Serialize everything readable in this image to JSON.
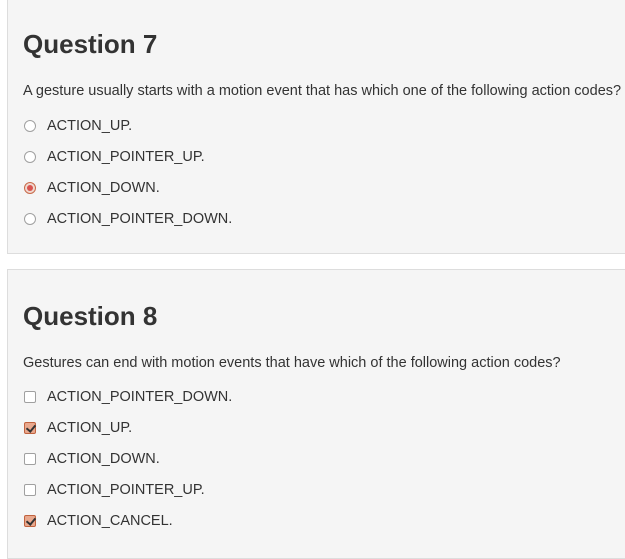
{
  "questions": [
    {
      "title": "Question 7",
      "text": "A gesture usually starts with a motion event that has which one of the following action codes?",
      "input_type": "radio",
      "options": [
        {
          "label": "ACTION_UP.",
          "checked": false
        },
        {
          "label": "ACTION_POINTER_UP.",
          "checked": false
        },
        {
          "label": "ACTION_DOWN.",
          "checked": true
        },
        {
          "label": "ACTION_POINTER_DOWN.",
          "checked": false
        }
      ]
    },
    {
      "title": "Question 8",
      "text": "Gestures can end with motion events that have which of the following action codes?",
      "input_type": "checkbox",
      "options": [
        {
          "label": "ACTION_POINTER_DOWN.",
          "checked": false
        },
        {
          "label": "ACTION_UP.",
          "checked": true
        },
        {
          "label": "ACTION_DOWN.",
          "checked": false
        },
        {
          "label": "ACTION_POINTER_UP.",
          "checked": false
        },
        {
          "label": "ACTION_CANCEL.",
          "checked": true
        }
      ]
    }
  ],
  "colors": {
    "panel_bg": "#f5f5f5",
    "panel_border": "#dddddd",
    "checked_accent": "#d9534f",
    "text": "#333333"
  }
}
